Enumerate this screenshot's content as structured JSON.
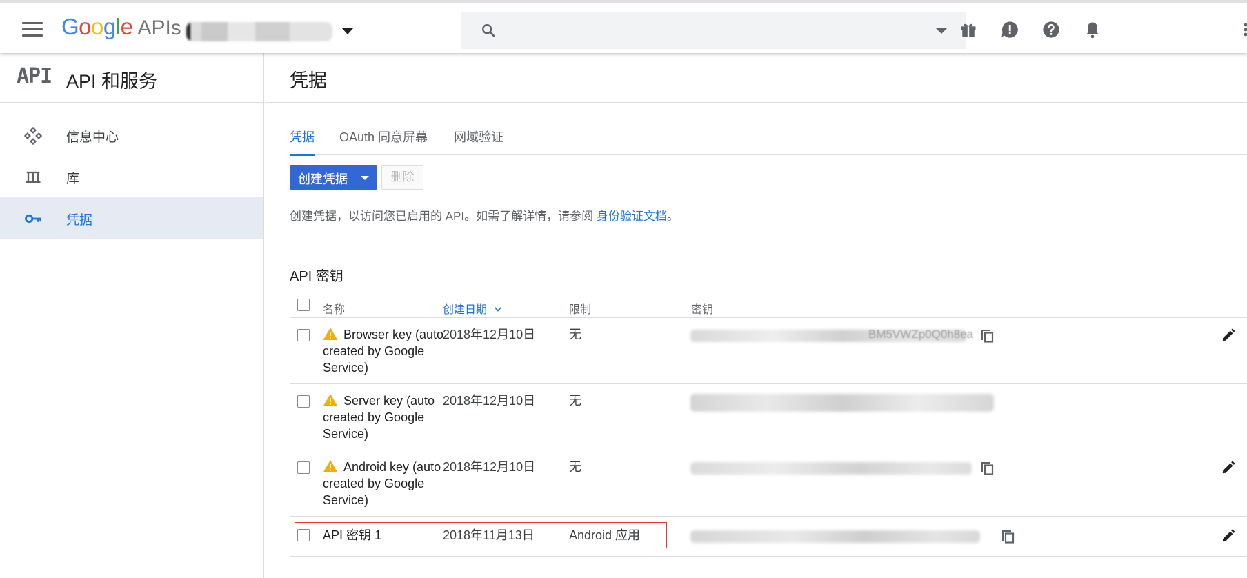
{
  "topbar": {
    "logo": {
      "g1": "G",
      "o1": "o",
      "o2": "o",
      "g2": "g",
      "l": "l",
      "e": "e",
      "apis": "APIs"
    },
    "search": {
      "placeholder": ""
    }
  },
  "sidebar": {
    "logo_text": "API",
    "title": "API 和服务",
    "items": [
      {
        "label": "信息中心",
        "icon": "dashboard-icon"
      },
      {
        "label": "库",
        "icon": "library-icon"
      },
      {
        "label": "凭据",
        "icon": "key-icon",
        "active": true
      }
    ]
  },
  "main": {
    "title": "凭据",
    "tabs": [
      {
        "label": "凭据",
        "active": true
      },
      {
        "label": "OAuth 同意屏幕"
      },
      {
        "label": "网域验证"
      }
    ],
    "create_button": "创建凭据",
    "delete_button": "删除",
    "description": "创建凭据，以访问您已启用的 API。如需了解详情，请参阅",
    "description_link": "身份验证文档",
    "description_end": "。",
    "section_title": "API 密钥",
    "table": {
      "columns": [
        "名称",
        "创建日期",
        "限制",
        "密钥"
      ],
      "rows": [
        {
          "name": "Browser key (auto created by Google Service)",
          "warning": true,
          "date": "2018年12月10日",
          "restriction": "无",
          "key_visible": "BM5VWZp0Q0h8ea"
        },
        {
          "name": "Server key (auto created by Google Service)",
          "warning": true,
          "date": "2018年12月10日",
          "restriction": "无"
        },
        {
          "name": "Android key (auto created by Google Service)",
          "warning": true,
          "date": "2018年12月10日",
          "restriction": "无"
        },
        {
          "name": "API 密钥 1",
          "warning": false,
          "date": "2018年11月13日",
          "restriction": "Android 应用"
        }
      ]
    }
  },
  "colors": {
    "accent": "#1a73e8",
    "button": "#3367d6",
    "warning": "#f9ab00",
    "highlight": "#e53935"
  }
}
